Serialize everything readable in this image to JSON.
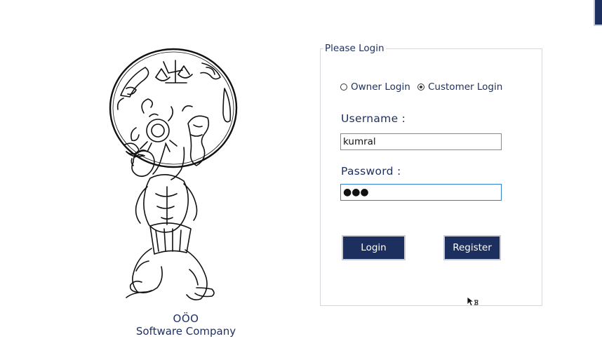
{
  "branding": {
    "company_name": "OÖO",
    "company_tagline": "Software Company",
    "logo_icon": "atlas-holding-zodiac-globe-icon"
  },
  "login_group": {
    "title": "Please Login",
    "login_type": {
      "options": [
        {
          "label": "Owner Login",
          "selected": false
        },
        {
          "label": "Customer Login",
          "selected": true
        }
      ]
    },
    "username": {
      "label": "Username :",
      "value": "kumral"
    },
    "password": {
      "label": "Password :",
      "masked_value": "●●●"
    },
    "buttons": {
      "login_label": "Login",
      "register_label": "Register"
    }
  },
  "colors": {
    "brand_navy": "#1d2f5e",
    "text_navy": "#1f3160",
    "focus_border": "#2f7fd4"
  }
}
